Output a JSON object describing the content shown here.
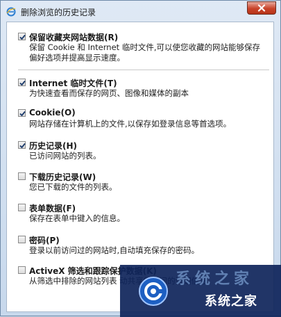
{
  "window": {
    "title": "删除浏览的历史记录"
  },
  "items": [
    {
      "label": "保留收藏夹网站数据(R)",
      "checked": true,
      "description": "保留 Cookie 和 Internet 临时文件,可以使您收藏的网站能够保存偏好选项并提高显示速度。"
    },
    {
      "label": "Internet 临时文件(T)",
      "checked": true,
      "description": "为快速查看而保存的网页、图像和媒体的副本"
    },
    {
      "label": "Cookie(O)",
      "checked": true,
      "description": "网站存储在计算机上的文件,以保存如登录信息等首选项。"
    },
    {
      "label": "历史记录(H)",
      "checked": true,
      "description": "已访问网站的列表。"
    },
    {
      "label": "下载历史记录(W)",
      "checked": false,
      "description": "您已下载的文件的列表。"
    },
    {
      "label": "表单数据(F)",
      "checked": false,
      "description": "保存在表单中键入的信息。"
    },
    {
      "label": "密码(P)",
      "checked": false,
      "description": "登录以前访问过的网站时,自动填充保存的密码。"
    },
    {
      "label": "ActiveX 筛选和跟踪保护数据(K)",
      "checked": false,
      "description": "从筛选中排除的网站列表 动共享您访问的详细信息"
    }
  ],
  "watermark": {
    "text": "系统之家",
    "big_text": "系统之家"
  }
}
